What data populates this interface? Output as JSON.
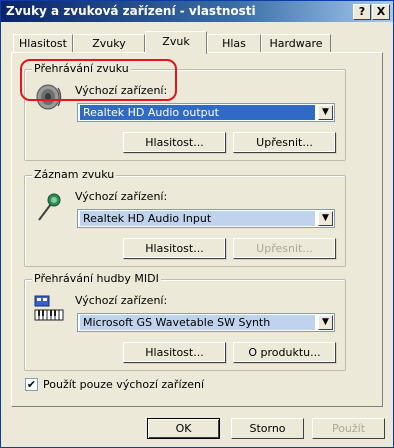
{
  "window": {
    "title": "Zvuky a zvuková zařízení - vlastnosti",
    "help_button": "?",
    "close_button": "X"
  },
  "tabs": [
    {
      "label": "Hlasitost",
      "active": false
    },
    {
      "label": "Zvuky",
      "active": false
    },
    {
      "label": "Zvuk",
      "active": true
    },
    {
      "label": "Hlas",
      "active": false
    },
    {
      "label": "Hardware",
      "active": false
    }
  ],
  "playback": {
    "title": "Přehrávání zvuku",
    "device_label": "Výchozí zařízení:",
    "device_value": "Realtek HD Audio output",
    "volume_button": "Hlasitost...",
    "advanced_button": "Upřesnit...",
    "icon": "speaker-icon"
  },
  "recording": {
    "title": "Záznam zvuku",
    "device_label": "Výchozí zařízení:",
    "device_value": "Realtek HD Audio Input",
    "volume_button": "Hlasitost...",
    "advanced_button": "Upřesnit...",
    "icon": "microphone-icon"
  },
  "midi": {
    "title": "Přehrávání hudby MIDI",
    "device_label": "Výchozí zařízení:",
    "device_value": "Microsoft GS Wavetable SW Synth",
    "volume_button": "Hlasitost...",
    "about_button": "O produktu...",
    "icon": "midi-keyboard-icon"
  },
  "default_only": {
    "label": "Použít pouze výchozí zařízení",
    "checked": true,
    "mark": "✔"
  },
  "footer": {
    "ok": "OK",
    "cancel": "Storno",
    "apply": "Použít"
  },
  "colors": {
    "title_bar": "#0a246a",
    "selection": "#316ac5",
    "annotation": "#e8141c"
  }
}
